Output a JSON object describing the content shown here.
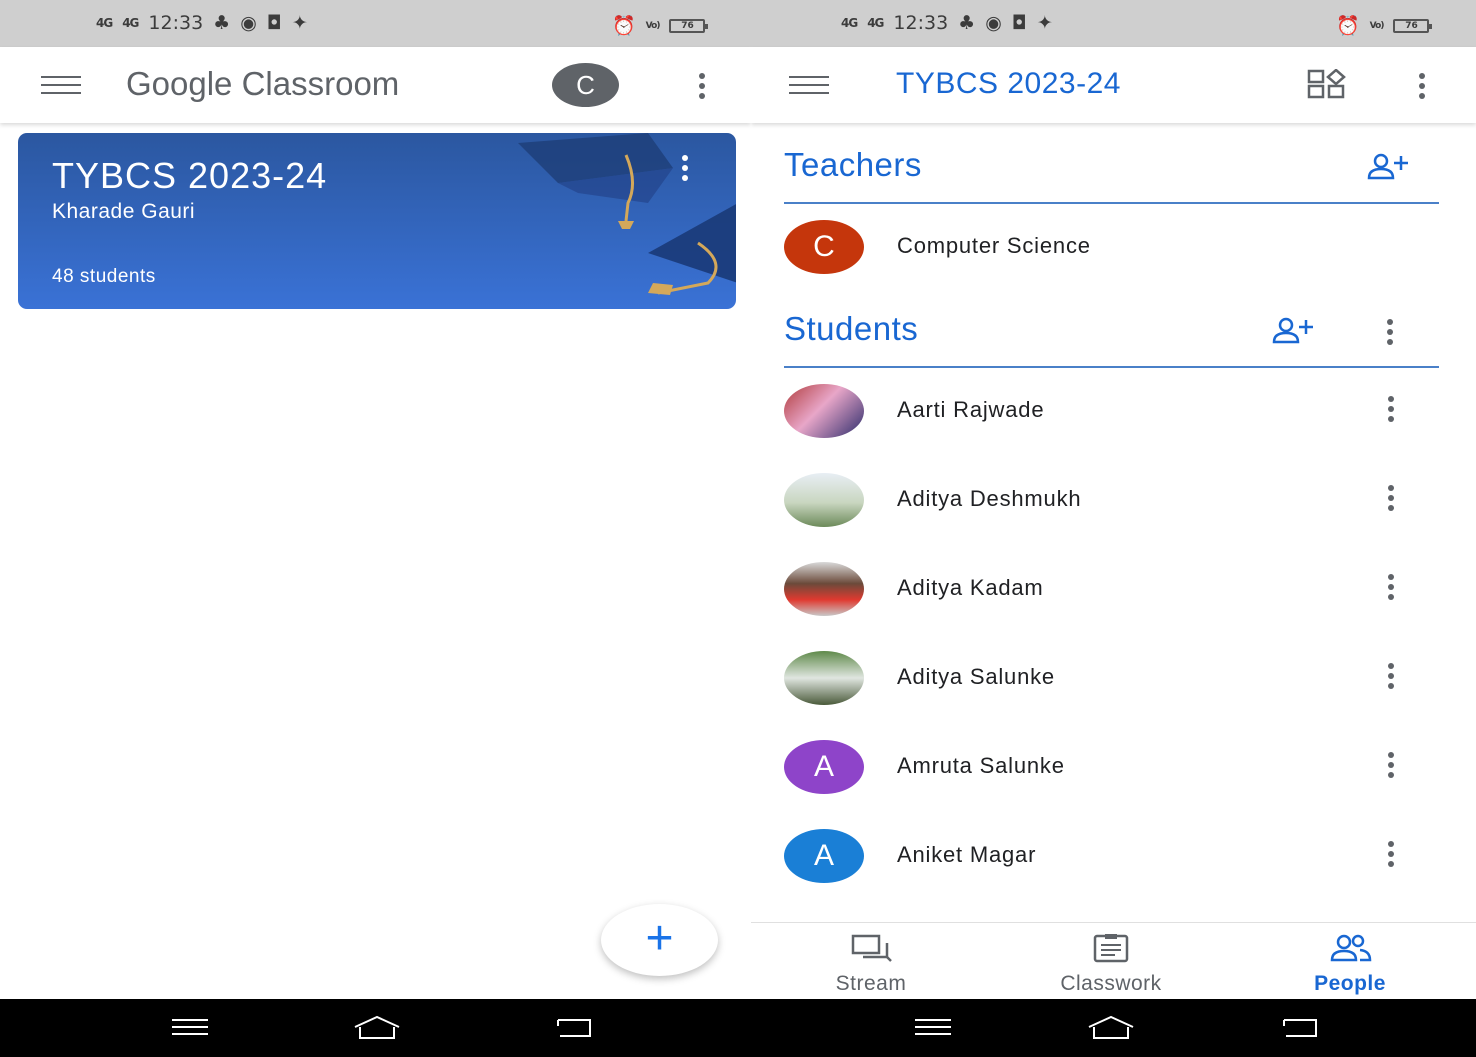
{
  "status_bar": {
    "left": {
      "signal1": "4G",
      "signal2": "4G",
      "time": "12:33"
    },
    "right": {
      "volte": "Vo)\nLTE1",
      "battery": "76"
    }
  },
  "left_screen": {
    "app_title_google": "Google",
    "app_title_classroom": "Classroom",
    "account_initial": "C",
    "class_card": {
      "title": "TYBCS 2023-24",
      "teacher": "Kharade Gauri",
      "students": "48 students"
    },
    "fab_label": "+"
  },
  "right_screen": {
    "class_title": "TYBCS 2023-24",
    "teachers_heading": "Teachers",
    "teachers": [
      {
        "name": "Computer Science",
        "initial": "C",
        "color": "#c5360c"
      }
    ],
    "students_heading": "Students",
    "students": [
      {
        "name": "Aarti Rajwade",
        "initial": "",
        "photo": true
      },
      {
        "name": "Aditya Deshmukh",
        "initial": "",
        "photo": true
      },
      {
        "name": "Aditya Kadam",
        "initial": "",
        "photo": true
      },
      {
        "name": "Aditya Salunke",
        "initial": "",
        "photo": true
      },
      {
        "name": "Amruta Salunke",
        "initial": "A",
        "color": "#8e44c9"
      },
      {
        "name": "Aniket Magar",
        "initial": "A",
        "color": "#1a7fd6"
      }
    ],
    "bottom_nav": [
      {
        "label": "Stream",
        "icon": "stream-icon",
        "active": false
      },
      {
        "label": "Classwork",
        "icon": "classwork-icon",
        "active": false
      },
      {
        "label": "People",
        "icon": "people-icon",
        "active": true
      }
    ]
  },
  "colors": {
    "accent": "#1967d2",
    "card_top": "#2b57a0",
    "card_bottom": "#3a72d6",
    "status_bar": "#cfcfcf"
  }
}
